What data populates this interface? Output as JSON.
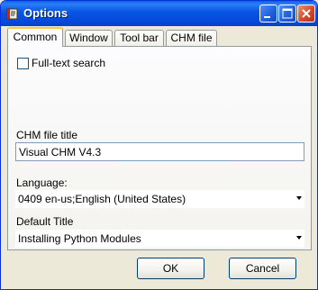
{
  "window": {
    "title": "Options",
    "icon": "chm-book-icon"
  },
  "tabs": [
    {
      "label": "Common",
      "selected": true
    },
    {
      "label": "Window",
      "selected": false
    },
    {
      "label": "Tool bar",
      "selected": false
    },
    {
      "label": "CHM file",
      "selected": false
    }
  ],
  "common": {
    "fulltext_label": "Full-text search",
    "fulltext_checked": false,
    "chm_title_label": "CHM file title",
    "chm_title_value": "Visual CHM V4.3",
    "language_label": "Language:",
    "language_value": "0409 en-us;English (United States)",
    "default_title_label": "Default Title",
    "default_title_value": "Installing Python Modules"
  },
  "buttons": {
    "ok": "OK",
    "cancel": "Cancel"
  },
  "colors": {
    "titlebar": "#0854e3",
    "close_button": "#d5492a",
    "selected_tab_accent": "#ffc83c",
    "face": "#ece9d8"
  }
}
